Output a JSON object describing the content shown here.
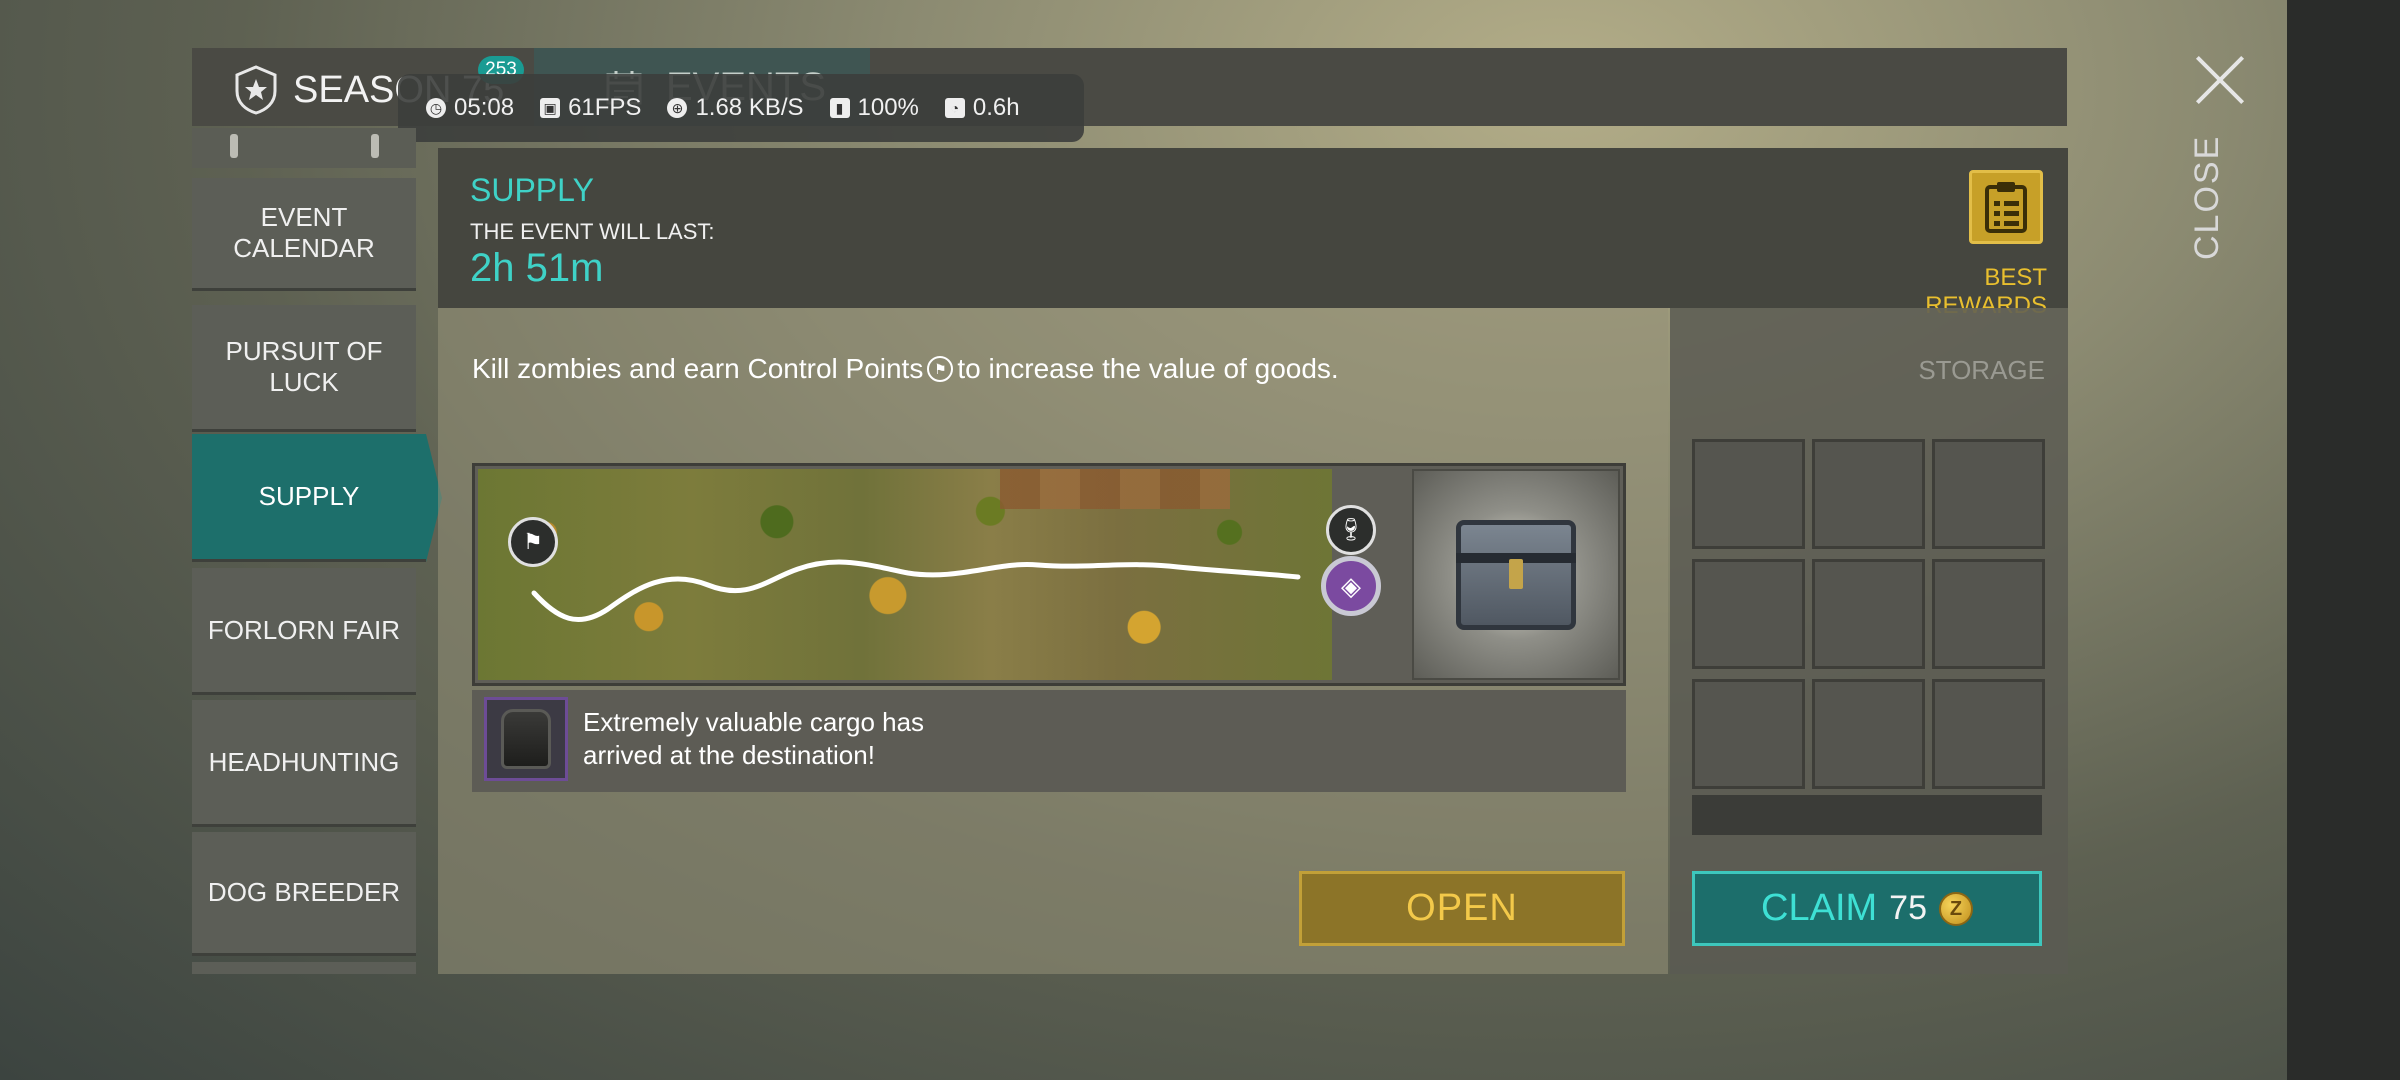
{
  "header_tabs": {
    "season_label": "SEASON 75",
    "season_badge": "253",
    "events_label": "EVENTS"
  },
  "perf_overlay": {
    "time": "05:08",
    "fps": "61FPS",
    "network": "1.68 KB/S",
    "battery": "100%",
    "duration": "0.6h"
  },
  "close": {
    "label": "CLOSE"
  },
  "sidebar": {
    "items": [
      {
        "label": "EVENT CALENDAR"
      },
      {
        "label": "PURSUIT OF LUCK"
      },
      {
        "label": "SUPPLY",
        "active": true
      },
      {
        "label": "FORLORN FAIR"
      },
      {
        "label": "HEADHUNTING"
      },
      {
        "label": "DOG BREEDER"
      }
    ]
  },
  "event": {
    "title": "SUPPLY",
    "duration_label": "THE EVENT WILL LAST:",
    "remaining": "2h 51m",
    "best_rewards_label": "BEST REWARDS",
    "description_before": "Kill zombies and earn Control Points",
    "description_after": " to increase the value of goods.",
    "cargo_message": "Extremely valuable cargo has arrived at the destination!",
    "open_label": "OPEN"
  },
  "storage": {
    "label": "STORAGE",
    "slots": 9,
    "claim_label": "CLAIM",
    "claim_amount": "75"
  },
  "colors": {
    "accent_teal": "#3fd2c7",
    "gold": "#e9bf2e",
    "active_tab": "#1d6f6b"
  },
  "icons": [
    "shield-icon",
    "calendar-icon",
    "clock-icon",
    "flag-icon",
    "wine-glass-icon",
    "cube-icon",
    "clipboard-icon",
    "coin-icon",
    "close-icon",
    "backpack-icon",
    "chest-icon"
  ]
}
